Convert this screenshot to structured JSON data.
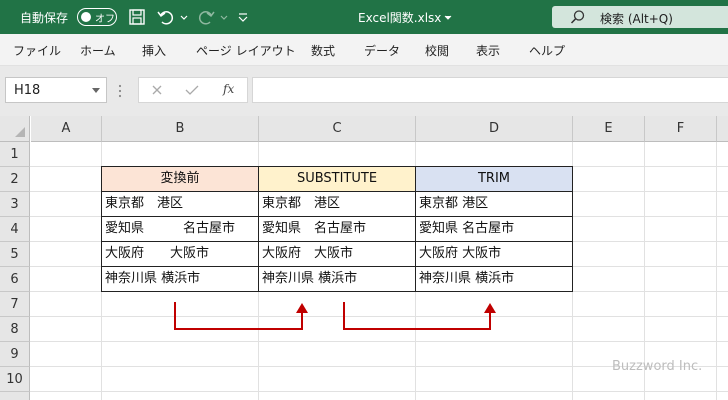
{
  "titlebar": {
    "autosave_label": "自動保存",
    "toggle_label": "オフ",
    "file_title": "Excel関数.xlsx",
    "search_label": "検索 (Alt+Q)"
  },
  "ribbon": {
    "tabs": [
      "ファイル",
      "ホーム",
      "挿入",
      "ページ レイアウト",
      "数式",
      "データ",
      "校閲",
      "表示",
      "ヘルプ"
    ]
  },
  "formula_bar": {
    "name_box": "H18",
    "fx": "fx",
    "formula": ""
  },
  "sheet": {
    "columns": [
      "A",
      "B",
      "C",
      "D",
      "E",
      "F"
    ],
    "rows": [
      "1",
      "2",
      "3",
      "4",
      "5",
      "6",
      "7",
      "8",
      "9",
      "10"
    ],
    "headers": [
      "変換前",
      "SUBSTITUTE",
      "TRIM"
    ],
    "header_colors": [
      "#fce4d6",
      "#fff2cc",
      "#d9e1f2"
    ],
    "data": [
      [
        "東京都　港区",
        "東京都　港区",
        "東京都 港区"
      ],
      [
        "愛知県　　　名古屋市",
        "愛知県　名古屋市",
        "愛知県 名古屋市"
      ],
      [
        "大阪府　　大阪市",
        "大阪府　大阪市",
        "大阪府 大阪市"
      ],
      [
        "神奈川県 横浜市",
        "神奈川県 横浜市",
        "神奈川県 横浜市"
      ]
    ],
    "arrow_color": "#c00000"
  },
  "watermark": "Buzzword Inc.",
  "colors": {
    "excel_green": "#217346"
  }
}
